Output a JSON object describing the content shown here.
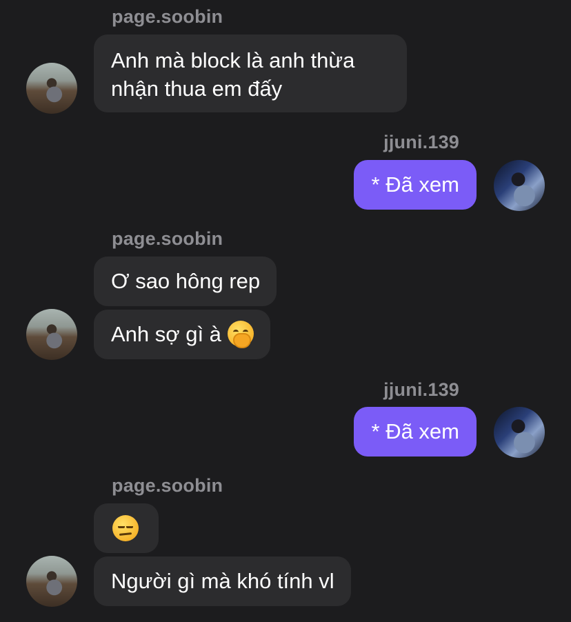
{
  "users": {
    "other": "page.soobin",
    "me": "jjuni.139"
  },
  "messages": {
    "m1": "Anh mà block là anh thừa nhận thua em đấy",
    "m2": "* Đã xem",
    "m3": "Ơ sao hông rep",
    "m4": "Anh sợ gì à",
    "m5": "* Đã xem",
    "m7": "Người gì mà khó tính vl"
  },
  "emojis": {
    "m4_trailing": "face-with-hand-over-mouth-emoji",
    "m6": "unamused-face-emoji"
  },
  "colors": {
    "background": "#1c1c1e",
    "incoming_bubble": "#2c2c2e",
    "outgoing_bubble": "#7b5cf7",
    "username": "#8e8e93"
  }
}
